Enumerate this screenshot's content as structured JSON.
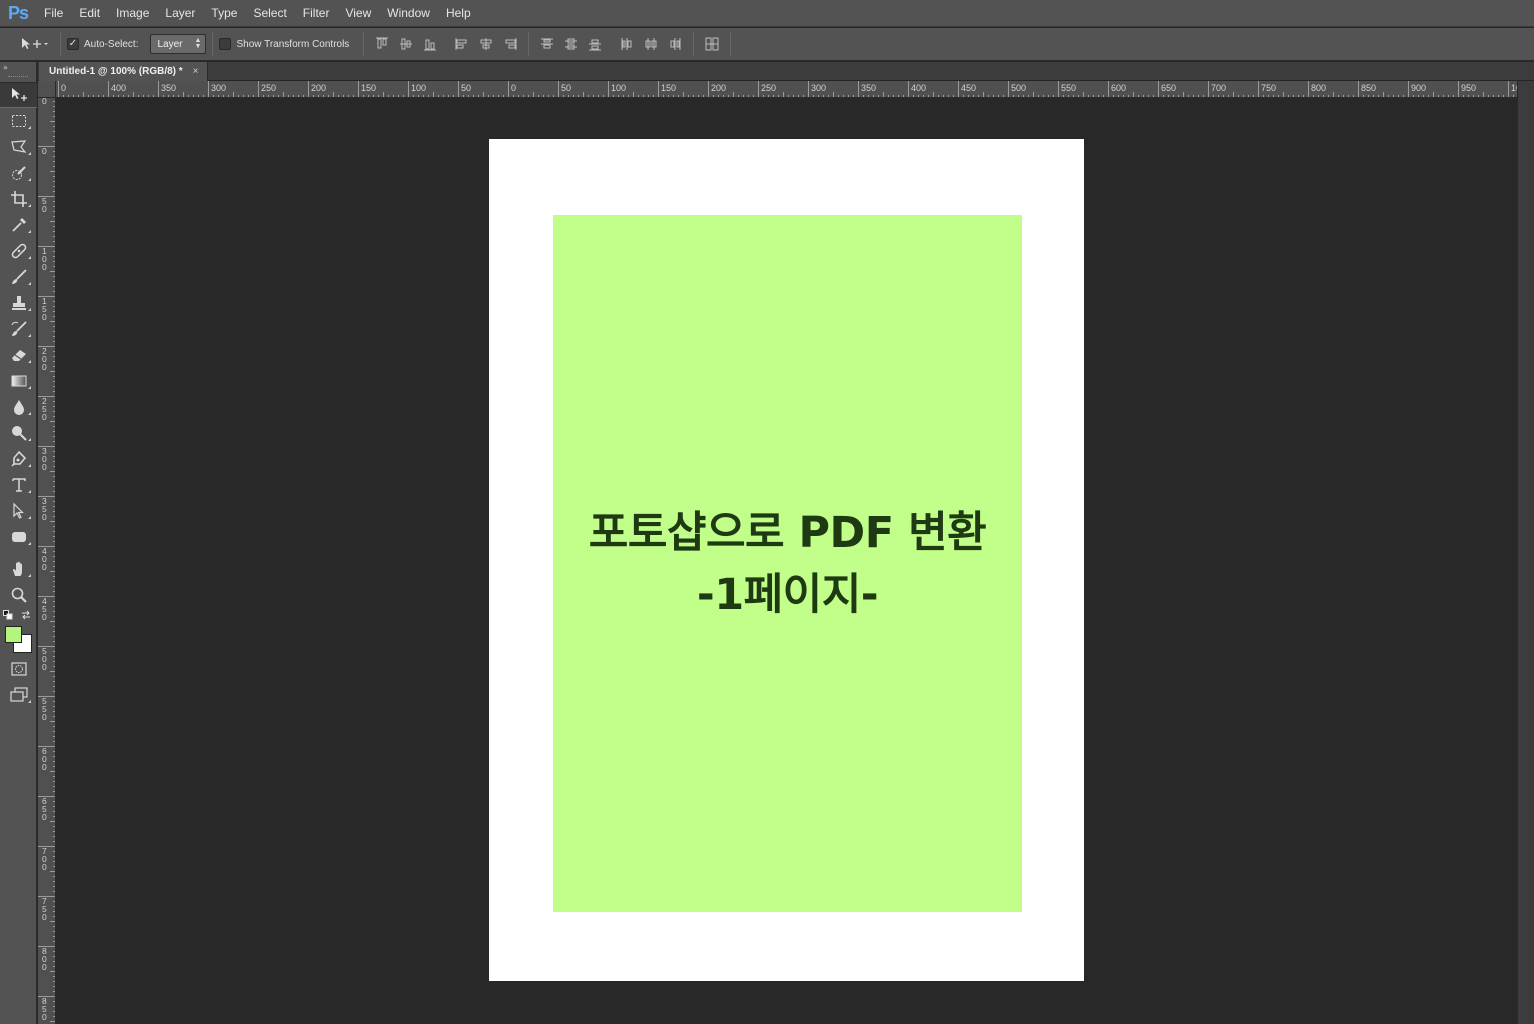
{
  "app": {
    "logo": "Ps",
    "menu": [
      "File",
      "Edit",
      "Image",
      "Layer",
      "Type",
      "Select",
      "Filter",
      "View",
      "Window",
      "Help"
    ]
  },
  "options_bar": {
    "auto_select_label": "Auto-Select:",
    "auto_select_checked": true,
    "auto_select_target": "Layer",
    "show_transform_label": "Show Transform Controls",
    "show_transform_checked": false
  },
  "document": {
    "tab_title": "Untitled-1 @ 100% (RGB/8) *",
    "tab_close": "×",
    "title_line1": "포토샵으로 PDF 변환",
    "title_line2": "-1페이지-",
    "page_color": "#ffffff",
    "content_color": "#c2ff8a",
    "text_color": "#1e3a12"
  },
  "rulers": {
    "horizontal_labels": [
      "0",
      "400",
      "350",
      "300",
      "250",
      "200",
      "150",
      "100",
      "50",
      "0",
      "50",
      "100",
      "150",
      "200",
      "250",
      "300",
      "350",
      "400",
      "450",
      "500",
      "550",
      "600",
      "650",
      "700",
      "750",
      "800",
      "850",
      "900",
      "950",
      "1000"
    ],
    "vertical_labels": [
      "0",
      "0",
      "50",
      "100",
      "150",
      "200",
      "250",
      "300",
      "350",
      "400",
      "450",
      "500",
      "550",
      "600",
      "650",
      "700",
      "750",
      "800",
      "850"
    ]
  },
  "colors": {
    "foreground": "#b5f57e",
    "background": "#ffffff",
    "ui_panel": "#535353",
    "workspace": "#282828"
  },
  "toolbar": {
    "collapse_glyph": "»",
    "tools": [
      "move-tool-icon",
      "marquee-tool-icon",
      "lasso-tool-icon",
      "quick-selection-tool-icon",
      "crop-tool-icon",
      "eyedropper-tool-icon",
      "healing-brush-tool-icon",
      "brush-tool-icon",
      "clone-stamp-tool-icon",
      "history-brush-tool-icon",
      "eraser-tool-icon",
      "gradient-tool-icon",
      "blur-tool-icon",
      "dodge-tool-icon",
      "pen-tool-icon",
      "type-tool-icon",
      "path-selection-tool-icon",
      "shape-tool-icon",
      "hand-tool-icon",
      "zoom-tool-icon"
    ]
  }
}
